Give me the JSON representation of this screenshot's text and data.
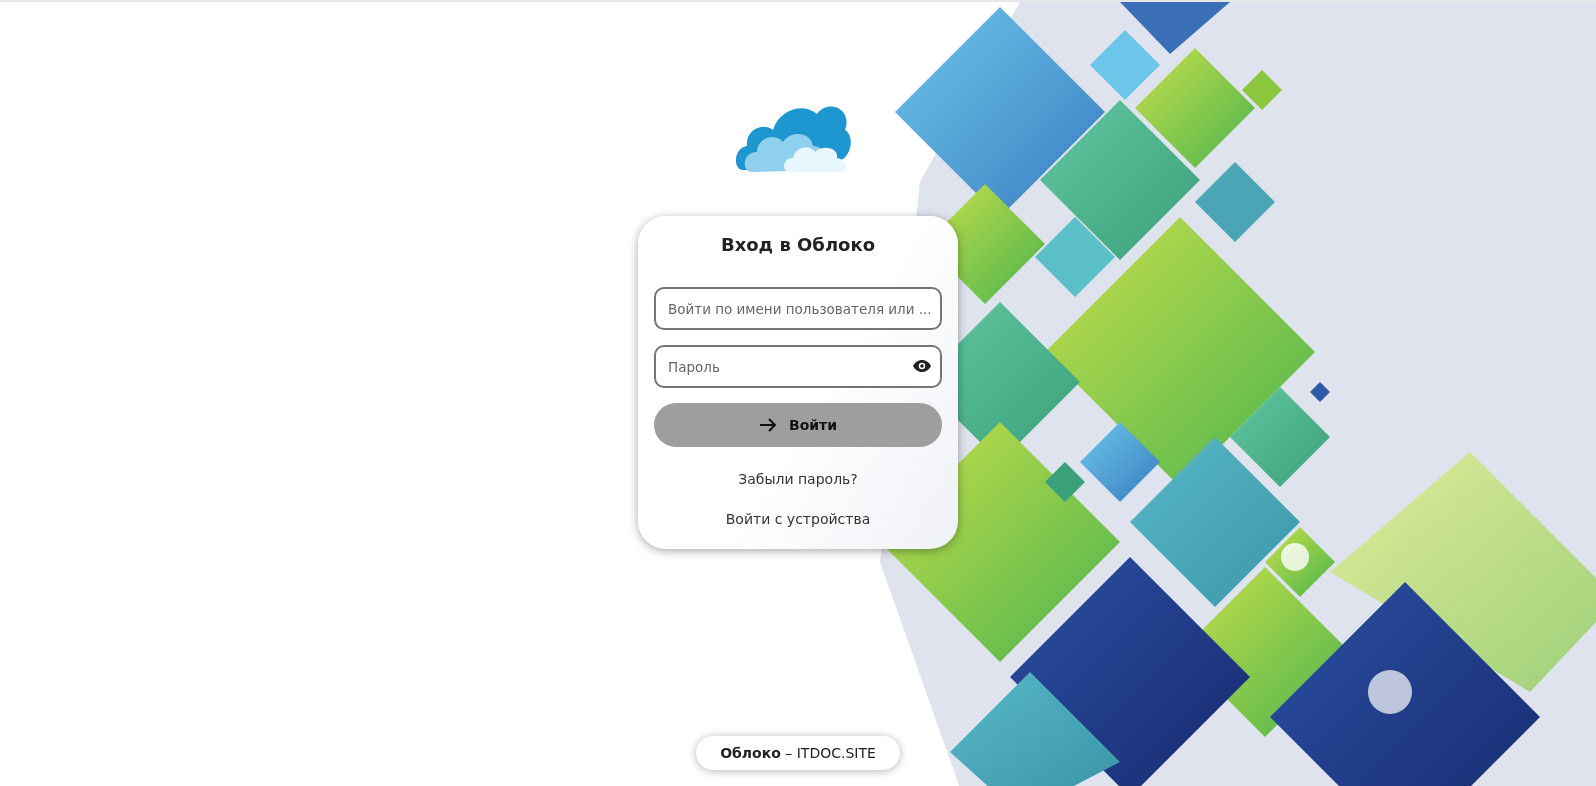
{
  "login": {
    "title": "Вход в Облоко",
    "username_field": {
      "placeholder": "Войти по имени пользователя или ..."
    },
    "password_field": {
      "placeholder": "Пароль"
    },
    "submit_button": {
      "label": "Войти"
    },
    "links": [
      {
        "label": "Забыли пароль?"
      },
      {
        "label": "Войти с устройства"
      }
    ]
  },
  "footer": {
    "text": "**Облоко** – ITDOC.SITE"
  }
}
